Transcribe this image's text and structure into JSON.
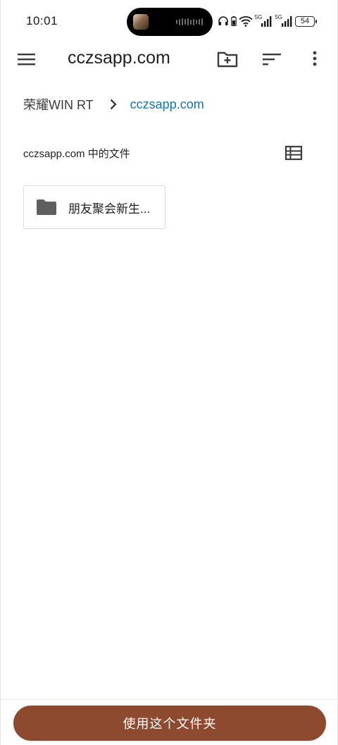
{
  "status_bar": {
    "time": "10:01",
    "battery": "54",
    "signal1_label": "5G",
    "signal2_label": "5G"
  },
  "toolbar": {
    "title": "cczsapp.com",
    "menu_icon": "hamburger-menu-icon",
    "new_folder_icon": "create-new-folder-icon",
    "sort_icon": "sort-icon",
    "more_icon": "more-vertical-icon"
  },
  "breadcrumb": {
    "root": "荣耀WIN RT",
    "current": "cczsapp.com"
  },
  "section": {
    "title": "cczsapp.com 中的文件",
    "view_icon": "list-view-icon"
  },
  "folders": [
    {
      "name": "朋友聚会新生...",
      "icon": "folder-icon"
    }
  ],
  "bottom": {
    "button_label": "使用这个文件夹"
  },
  "colors": {
    "accent": "#1a73a8",
    "button": "#8e4a2f",
    "icon": "#5f5f5f"
  }
}
